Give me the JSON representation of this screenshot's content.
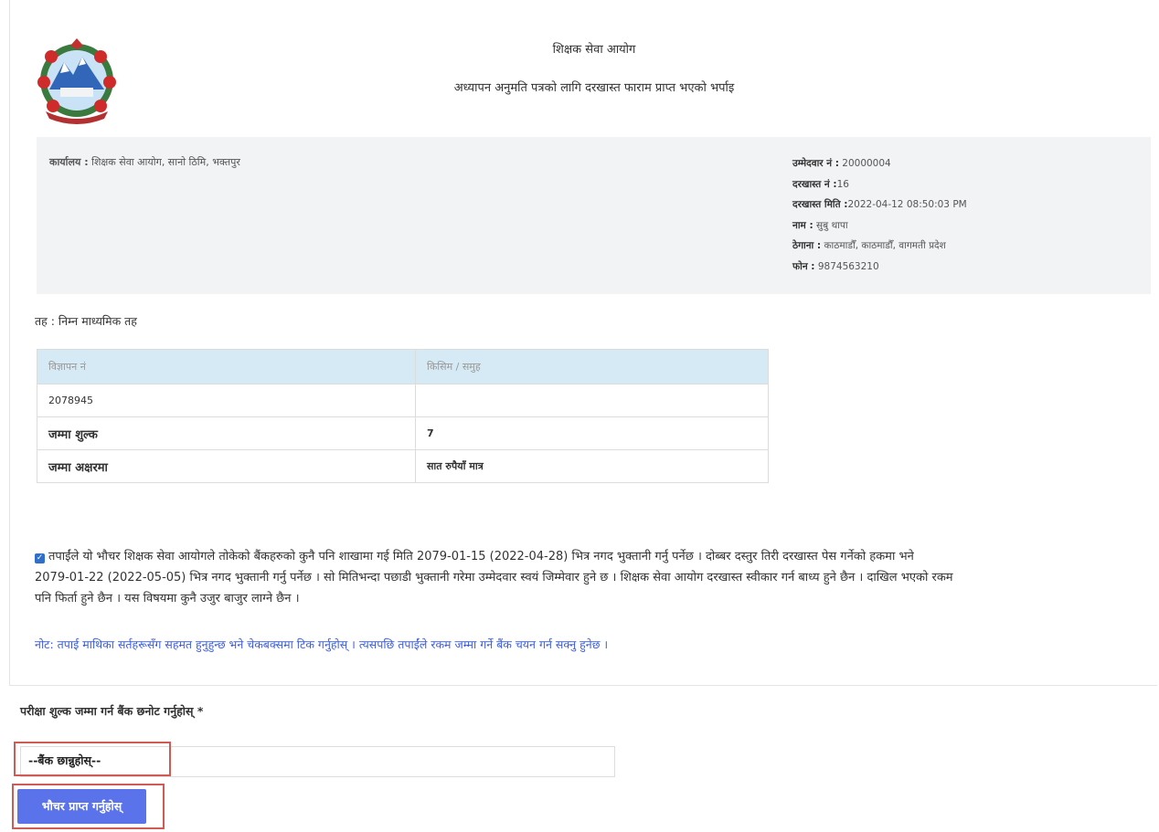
{
  "header": {
    "org_name": "शिक्षक सेवा आयोग",
    "subtitle": "अध्यापन अनुमति पत्रको लागि दरखास्त फाराम प्राप्त भएको भर्पाइ"
  },
  "office": {
    "label": "कार्यालय :",
    "value": "शिक्षक सेवा आयोग, सानो ठिमि, भक्तपुर"
  },
  "candidate": {
    "number_label": "उम्मेदवार नं :",
    "number_value": "20000004",
    "application_no_label": "दरखास्त नं :",
    "application_no_value": "16",
    "application_date_label": "दरखास्त मिति :",
    "application_date_value": "2022-04-12 08:50:03 PM",
    "name_label": "नाम :",
    "name_value": "सुबु थापा",
    "address_label": "ठेगाना :",
    "address_value": "काठमाडौँ, काठमाडौँ, वागमती प्रदेश",
    "phone_label": "फोन :",
    "phone_value": "9874563210"
  },
  "level": "तह : निम्न माध्यमिक तह",
  "table": {
    "headers": [
      "विज्ञापन नं",
      "किसिम / समुह"
    ],
    "rows": [
      [
        "2078945",
        ""
      ],
      [
        "जम्मा शुल्क",
        "7"
      ],
      [
        "जम्मा अक्षरमा",
        "सात रुपैयाँ मात्र"
      ]
    ]
  },
  "declaration": {
    "line1": "तपाईंले यो भौचर शिक्षक सेवा आयोगले तोकेको बैंकहरुको कुनै पनि शाखामा गई मिति 2079-01-15 (2022-04-28) भित्र नगद भुक्तानी गर्नु पर्नेछ । दोब्बर दस्तुर तिरी दरखास्त पेस गर्नेको हकमा भने",
    "line2": "2079-01-22 (2022-05-05) भित्र नगद भुक्तानी गर्नु पर्नेछ । सो मितिभन्दा पछाडी भुक्तानी गरेमा उम्मेदवार स्वयं जिम्मेवार हुने छ । शिक्षक सेवा आयोग दरखास्त स्वीकार गर्न बाध्य हुने छैन । दाखिल भएको रकम",
    "line3": "पनि फिर्ता हुने छैन । यस विषयमा कुनै उजुर बाजुर लाग्ने छैन ।"
  },
  "note": "नोट: तपाई माथिका सर्तहरूसँग सहमत हुनुहुन्छ भने चेकबक्समा टिक गर्नुहोस् । त्यसपछि तपाईंले रकम जम्मा गर्ने बैंक चयन गर्न सक्नु हुनेछ ।",
  "bank": {
    "label": "परीक्षा शुल्क जम्मा गर्न बैंक छनोट गर्नुहोस् *",
    "selected": "--बैंक छान्नुहोस्--"
  },
  "voucher_button": "भौचर प्राप्त गर्नुहोस्",
  "colors": {
    "accent_button": "#5b73ea",
    "note_blue": "#3b5de0",
    "highlight_red": "#d05a54",
    "table_header": "#d6eaf6"
  }
}
